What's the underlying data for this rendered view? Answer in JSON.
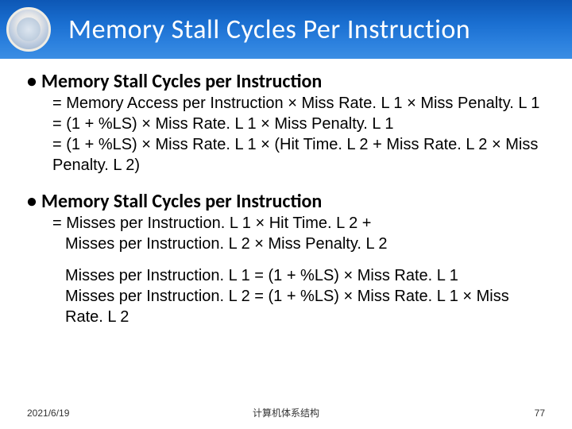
{
  "header": {
    "title": "Memory Stall Cycles Per Instruction"
  },
  "section1": {
    "heading": "Memory Stall Cycles per Instruction",
    "line1": "= Memory Access per Instruction × Miss Rate. L 1 × Miss Penalty. L 1",
    "line2": "= (1 + %LS) × Miss Rate. L 1 × Miss Penalty. L 1",
    "line3": "= (1 + %LS) × Miss Rate. L 1 × (Hit Time. L 2 + Miss Rate. L 2 × Miss Penalty. L 2)"
  },
  "section2": {
    "heading": "Memory Stall Cycles per Instruction",
    "line1": "= Misses per Instruction. L 1 × Hit Time. L 2 +",
    "line2": "Misses per Instruction. L 2 × Miss Penalty. L 2",
    "line3": "Misses per Instruction. L 1 = (1 + %LS) × Miss Rate. L 1",
    "line4": "Misses per Instruction. L 2 = (1 + %LS) × Miss Rate. L 1 × Miss Rate. L 2"
  },
  "footer": {
    "date": "2021/6/19",
    "center": "计算机体系结构",
    "page": "77"
  }
}
